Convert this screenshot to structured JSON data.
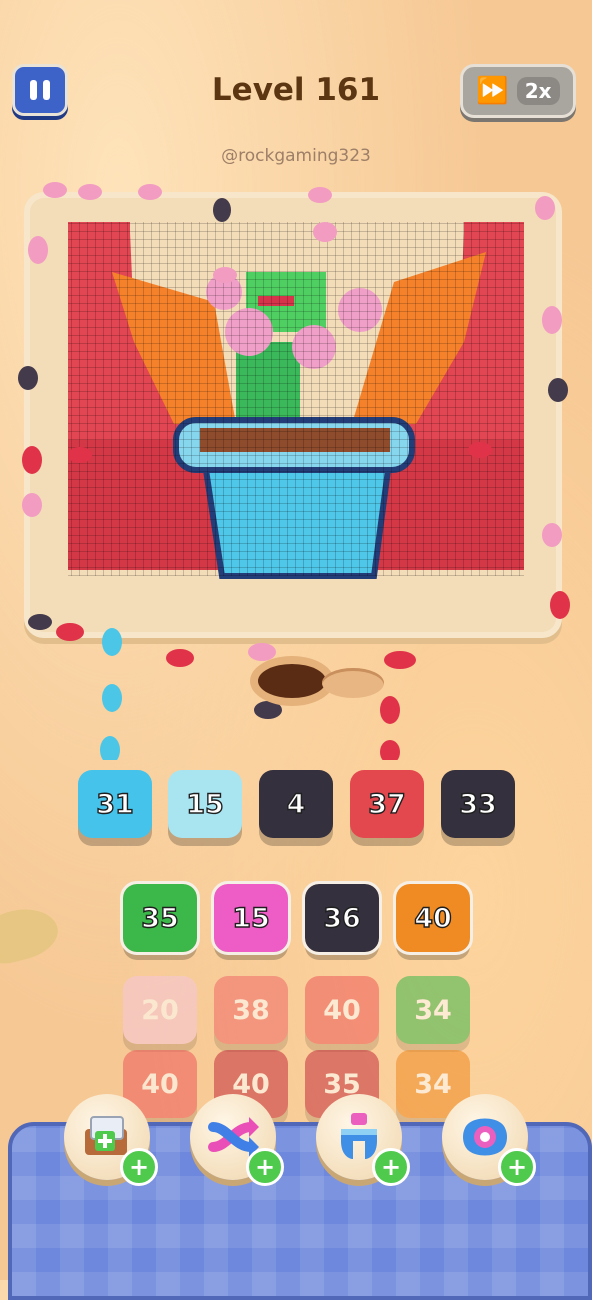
{
  "header": {
    "level_title": "Level 161",
    "speed_label": "2x",
    "watermark": "@rockgaming323"
  },
  "icons": [
    "pause-icon",
    "fast-forward-icon",
    "add-slot-icon",
    "shuffle-icon",
    "magnet-icon",
    "vacuum-icon",
    "plus-icon"
  ],
  "colors": {
    "cyan": "#45c3ea",
    "light_cyan": "#a9e4f1",
    "dark": "#34303d",
    "red": "#e4484f",
    "green": "#3cb74a",
    "pink": "#ee5cc5",
    "orange": "#f08a22",
    "pale_pink": "#f6c7dc",
    "salmon": "#ef6a68",
    "crimson": "#c52f3e"
  },
  "queue": [
    {
      "value": "31",
      "color": "#45c3ea"
    },
    {
      "value": "15",
      "color": "#a9e4f1"
    },
    {
      "value": "4",
      "color": "#34303d"
    },
    {
      "value": "37",
      "color": "#e4484f"
    },
    {
      "value": "33",
      "color": "#34303d"
    }
  ],
  "grid": [
    [
      {
        "value": "35",
        "color": "#3cb74a",
        "active": true
      },
      {
        "value": "15",
        "color": "#ee5cc5",
        "active": true
      },
      {
        "value": "36",
        "color": "#34303d",
        "active": true
      },
      {
        "value": "40",
        "color": "#f08a22",
        "active": true
      }
    ],
    [
      {
        "value": "20",
        "color": "#f6c7dc",
        "active": false
      },
      {
        "value": "38",
        "color": "#ef6a68",
        "active": false
      },
      {
        "value": "40",
        "color": "#ef5a5a",
        "active": false
      },
      {
        "value": "34",
        "color": "#3cb74a",
        "active": false
      }
    ],
    [
      {
        "value": "40",
        "color": "#ef5a5a",
        "active": false
      },
      {
        "value": "40",
        "color": "#c52f3e",
        "active": false
      },
      {
        "value": "35",
        "color": "#c52f3e",
        "active": false
      },
      {
        "value": "34",
        "color": "#f08a22",
        "active": false
      }
    ]
  ],
  "boosters": [
    {
      "name": "add-slot",
      "icon": "add-slot-icon",
      "badge": "+"
    },
    {
      "name": "shuffle",
      "icon": "shuffle-icon",
      "badge": "+"
    },
    {
      "name": "magnet",
      "icon": "magnet-icon",
      "badge": "+"
    },
    {
      "name": "vacuum",
      "icon": "vacuum-icon",
      "badge": "+"
    }
  ]
}
